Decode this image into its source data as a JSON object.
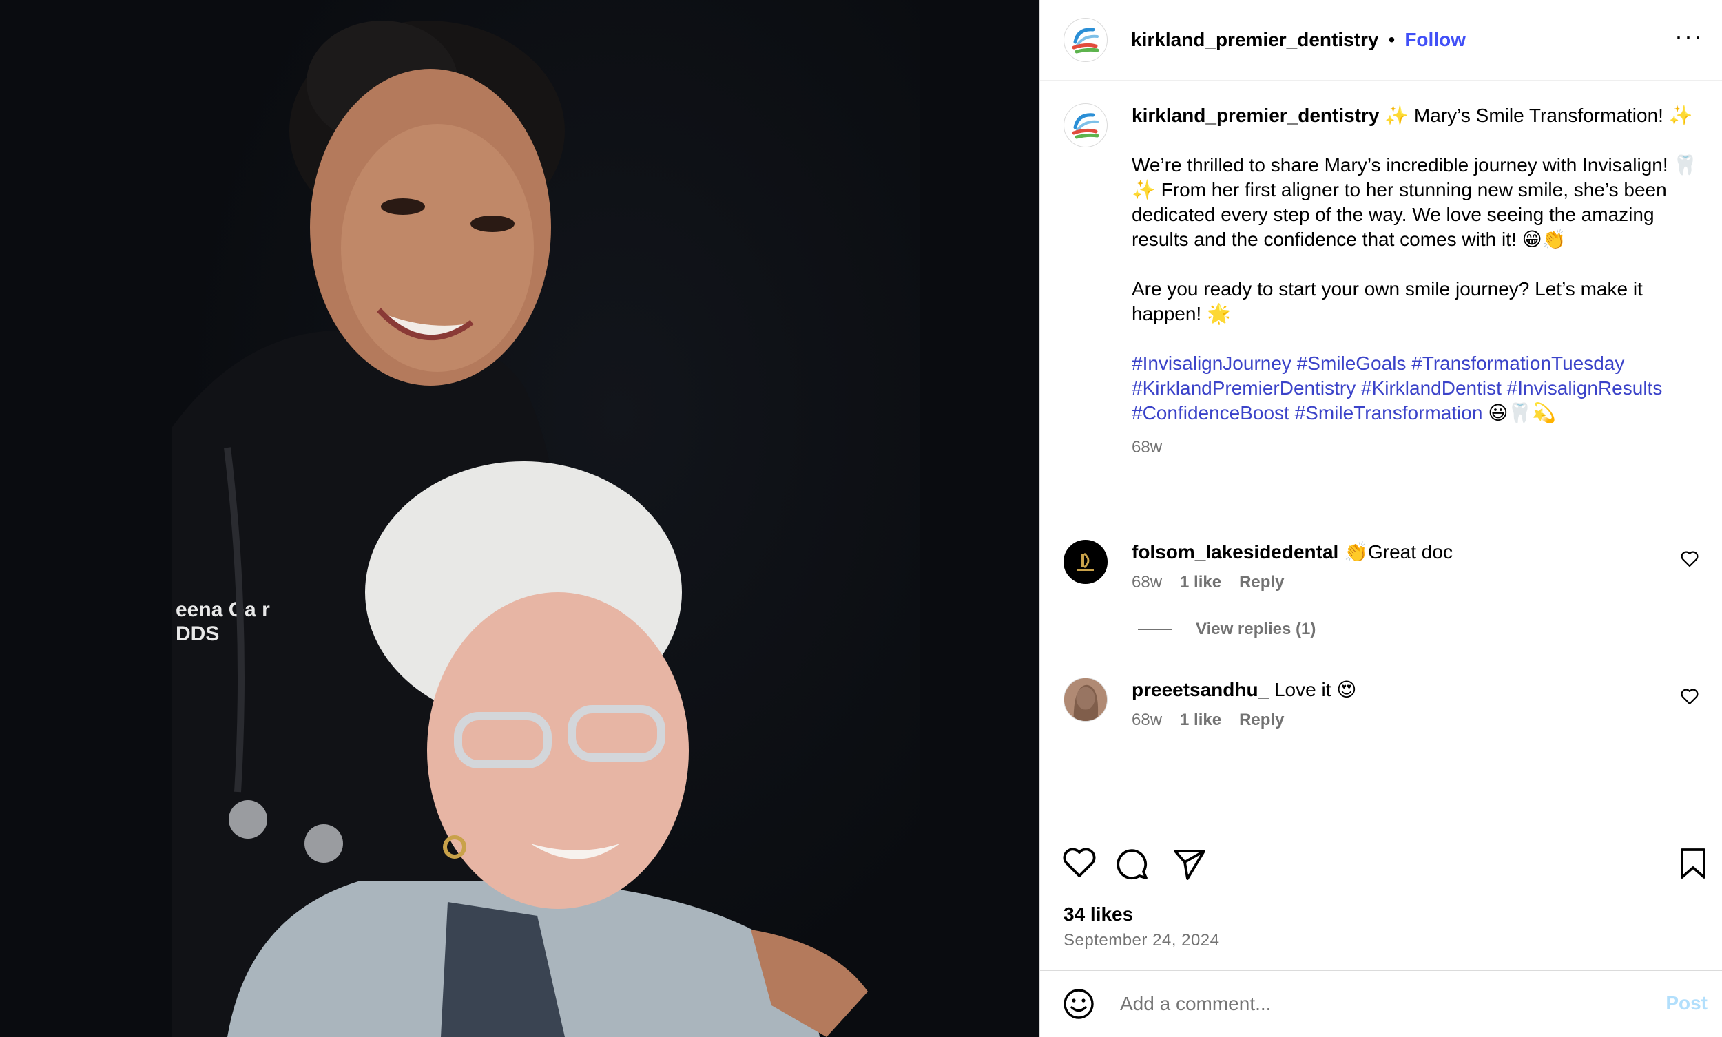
{
  "photo": {
    "description_icon": "photo-image",
    "badge_line1": "eena Ga r",
    "badge_line2": "DDS"
  },
  "header": {
    "username": "kirkland_premier_dentistry",
    "separator": "•",
    "follow_label": "Follow",
    "more_icon": "more-options-icon",
    "more_glyph": "···"
  },
  "caption": {
    "username": "kirkland_premier_dentistry",
    "title": " ✨ Mary’s Smile Transformation! ✨",
    "paragraph1": "We’re thrilled to share Mary’s incredible journey with Invisalign! 🦷✨ From her first aligner to her stunning new smile, she’s been dedicated every step of the way. We love seeing the amazing results and the confidence that comes with it! 😁👏",
    "paragraph2": "Are you ready to start your own smile journey? Let’s make it happen! 🌟",
    "hashtags": "#InvisalignJourney #SmileGoals #TransformationTuesday #KirklandPremierDentistry #KirklandDentist #InvisalignResults #ConfidenceBoost #SmileTransformation",
    "hashtag_emoji": " 😃🦷💫",
    "time": "68w"
  },
  "comments": [
    {
      "username": "folsom_lakesidedental",
      "text": " 👏Great doc",
      "time": "68w",
      "likes": "1 like",
      "reply": "Reply"
    },
    {
      "username": "preeetsandhu_",
      "text": " Love it 😍",
      "time": "68w",
      "likes": "1 like",
      "reply": "Reply"
    }
  ],
  "view_replies": "View replies (1)",
  "actions": {
    "likes": "34 likes",
    "date": "September 24, 2024"
  },
  "composer": {
    "placeholder": "Add a comment...",
    "post_label": "Post"
  },
  "colors": {
    "accent": "#4150f7",
    "hashtag": "#3b43c9",
    "muted": "#737373",
    "post_disabled": "#b2dffc"
  }
}
